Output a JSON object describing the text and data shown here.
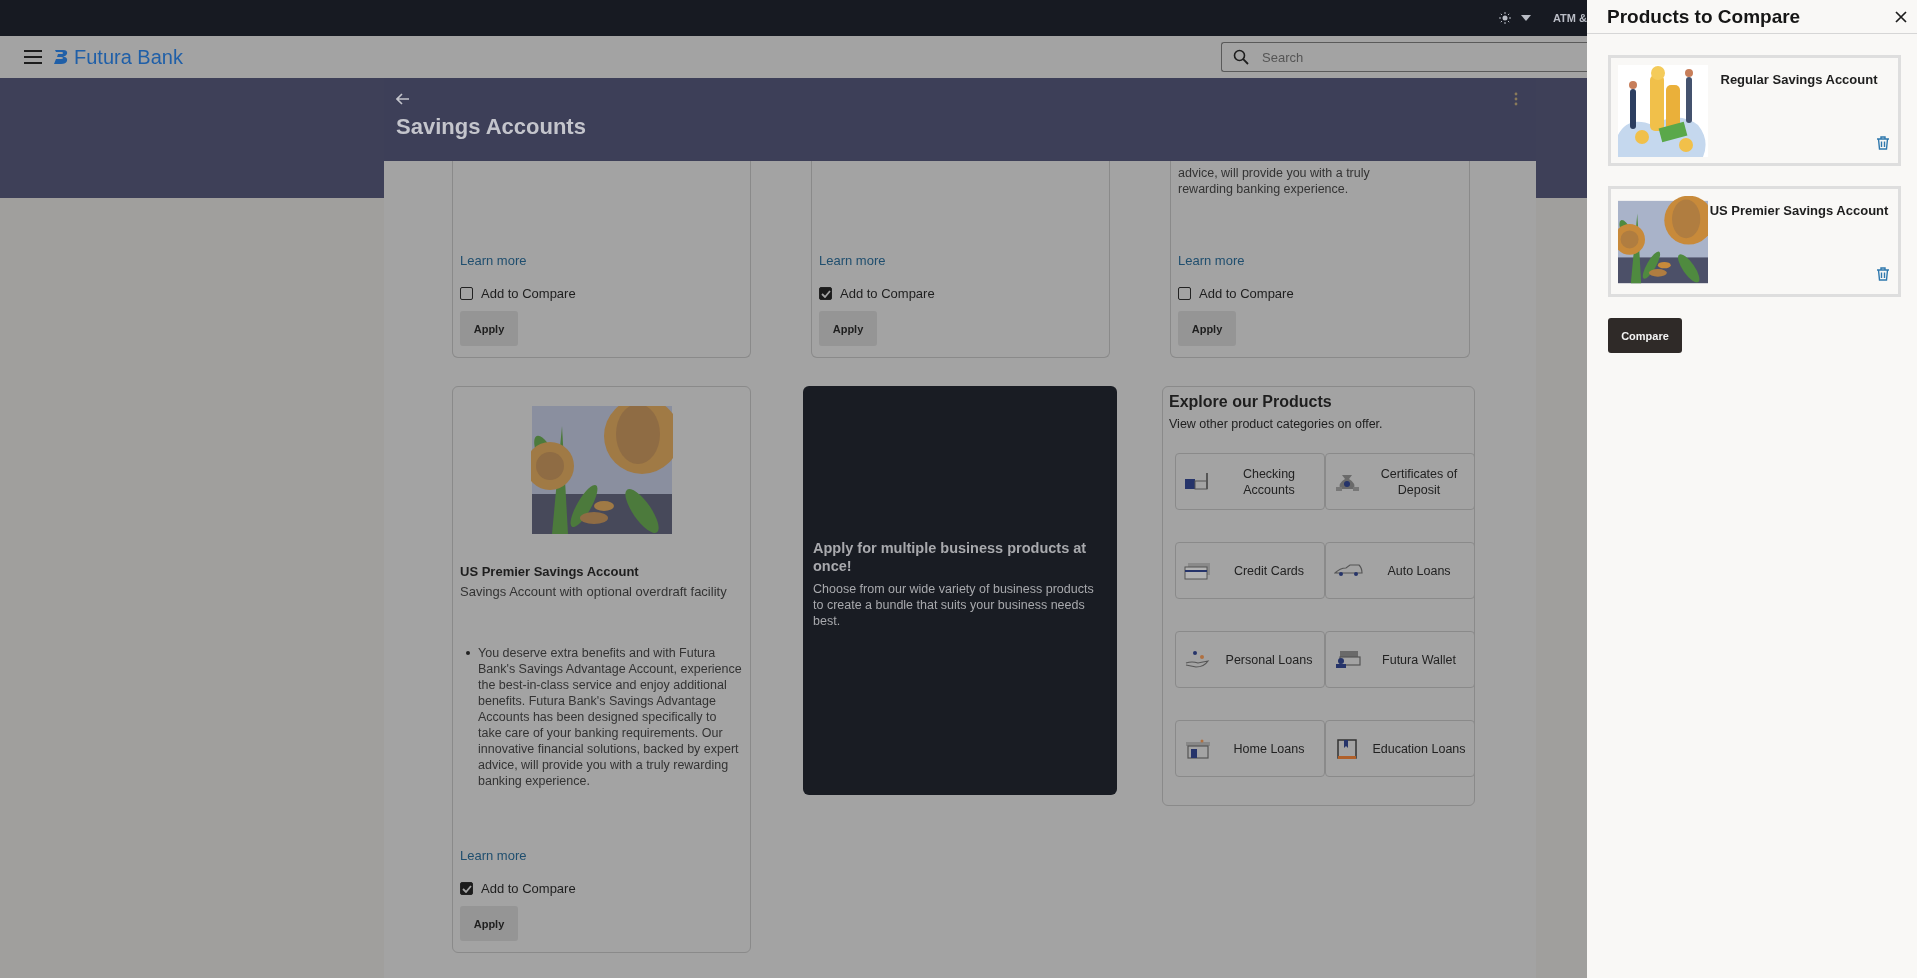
{
  "top_bar": {
    "menu_text": "ATM &"
  },
  "header": {
    "brand": "Futura Bank",
    "search": {
      "placeholder": "Search"
    }
  },
  "page": {
    "title": "Savings Accounts"
  },
  "products": [
    {
      "link": "Learn more",
      "compare_label": "Add to Compare",
      "compare_checked": false,
      "button": "Apply"
    },
    {
      "link": "Learn more",
      "compare_label": "Add to Compare",
      "compare_checked": true,
      "button": "Apply"
    },
    {
      "description": "advice, will provide you with a truly rewarding banking experience.",
      "link": "Learn more",
      "compare_label": "Add to Compare",
      "compare_checked": false,
      "button": "Apply"
    },
    {
      "image": {
        "kind": "picture"
      },
      "name": "US Premier Savings Account",
      "subtitle": "Savings Account with optional overdraft facility",
      "bullets": [
        "You deserve extra benefits and with Futura Bank's Savings Advantage Account, experience the best-in-class service and enjoy additional benefits. Futura Bank's Savings Advantage Accounts has been designed specifically to take care of your banking requirements. Our innovative financial solutions, backed by expert advice, will provide you with a truly rewarding banking experience."
      ],
      "link": "Learn more",
      "compare_label": "Add to Compare",
      "compare_checked": true,
      "button": "Apply"
    }
  ],
  "promo": {
    "title": "Apply for multiple business products at once!",
    "text": "Choose from our wide variety of business products to create a bundle that suits your business needs best."
  },
  "explore": {
    "title": "Explore our Products",
    "subtitle": "View other product categories on offer.",
    "tiles": [
      {
        "label": "Checking Accounts"
      },
      {
        "label": "Certificates of Deposit"
      },
      {
        "label": "Credit Cards"
      },
      {
        "label": "Auto Loans"
      },
      {
        "label": "Personal Loans"
      },
      {
        "label": "Futura Wallet"
      },
      {
        "label": "Home Loans"
      },
      {
        "label": "Education Loans"
      }
    ]
  },
  "compare_panel": {
    "title": "Products to Compare",
    "items": [
      {
        "name": "Regular Savings Account",
        "image": {
          "kind": "picture"
        }
      },
      {
        "name": "US Premier Savings Account",
        "image": {
          "kind": "picture"
        }
      }
    ],
    "button": "Compare"
  }
}
